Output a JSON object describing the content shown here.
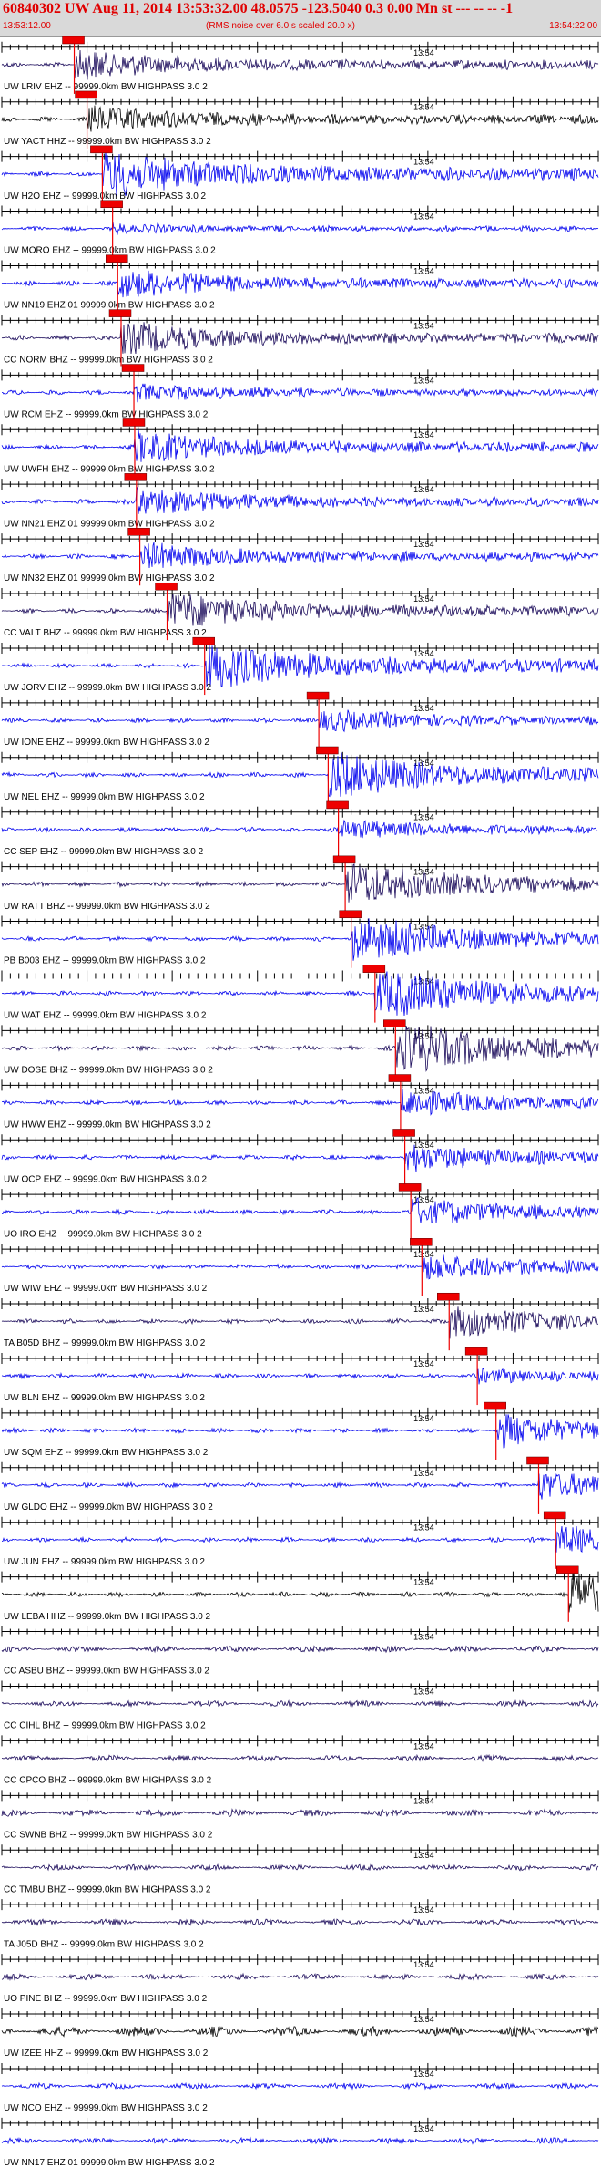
{
  "header": {
    "title": "60840302 UW Aug 11, 2014 13:53:32.00   48.0575 -123.5040  0.3 0.00 Mn st --- -- --   -1",
    "start_time": "13:53:12.00",
    "note": "(RMS noise over 6.0 s scaled 20.0 x)",
    "end_time": "13:54:22.00"
  },
  "colors": {
    "blue": "#0000ee",
    "navy": "#1a0a5a",
    "black": "#000000",
    "pick": "#ee0000",
    "header_bg": "#d9d9d9"
  },
  "chart_data": {
    "type": "line",
    "title": "60840302 UW Aug 11, 2014 13:53:32.00   48.0575 -123.5040  0.3 0.00 Mn st --- -- --   -1",
    "x_range": [
      "13:53:12.00",
      "13:54:22.00"
    ],
    "minute_marker": "13:54",
    "series": [
      {
        "name": "UW LRIV EHZ -- 99999.0km BW  HIGHPASS  3.0  2",
        "color": "navy",
        "pick_s": 8.5,
        "amp": 0.55
      },
      {
        "name": "UW YACT HHZ -- 99999.0km BW  HIGHPASS  3.0  2",
        "color": "black",
        "pick_s": 10.0,
        "amp": 0.5
      },
      {
        "name": "UW H2O EHZ -- 99999.0km BW  HIGHPASS  3.0  2",
        "color": "blue",
        "pick_s": 11.8,
        "amp": 0.9
      },
      {
        "name": "UW MORO EHZ -- 99999.0km BW  HIGHPASS  3.0  2",
        "color": "blue",
        "pick_s": 13.0,
        "amp": 0.15
      },
      {
        "name": "UW NN19 EHZ 01 99999.0km BW  HIGHPASS  3.0  2",
        "color": "blue",
        "pick_s": 13.6,
        "amp": 0.55
      },
      {
        "name": "CC NORM BHZ -- 99999.0km BW  HIGHPASS  3.0  2",
        "color": "navy",
        "pick_s": 14.0,
        "amp": 0.6
      },
      {
        "name": "UW RCM EHZ -- 99999.0km BW  HIGHPASS  3.0  2",
        "color": "blue",
        "pick_s": 15.5,
        "amp": 0.3
      },
      {
        "name": "UW UWFH EHZ -- 99999.0km BW  HIGHPASS  3.0  2",
        "color": "blue",
        "pick_s": 15.6,
        "amp": 0.6
      },
      {
        "name": "UW NN21 EHZ 01 99999.0km BW  HIGHPASS  3.0  2",
        "color": "blue",
        "pick_s": 15.8,
        "amp": 0.5
      },
      {
        "name": "UW NN32 EHZ 01 99999.0km BW  HIGHPASS  3.0  2",
        "color": "blue",
        "pick_s": 16.2,
        "amp": 0.5
      },
      {
        "name": "CC VALT BHZ -- 99999.0km BW  HIGHPASS  3.0  2",
        "color": "navy",
        "pick_s": 19.4,
        "amp": 0.7
      },
      {
        "name": "UW JORV EHZ -- 99999.0km BW  HIGHPASS  3.0  2",
        "color": "blue",
        "pick_s": 23.8,
        "amp": 0.9
      },
      {
        "name": "UW IONE EHZ -- 99999.0km BW  HIGHPASS  3.0  2",
        "color": "blue",
        "pick_s": 37.2,
        "amp": 0.4
      },
      {
        "name": "UW NEL EHZ -- 99999.0km BW  HIGHPASS  3.0  2",
        "color": "blue",
        "pick_s": 38.3,
        "amp": 0.9
      },
      {
        "name": "CC SEP EHZ -- 99999.0km BW  HIGHPASS  3.0  2",
        "color": "blue",
        "pick_s": 39.5,
        "amp": 0.35
      },
      {
        "name": "UW RATT BHZ -- 99999.0km BW  HIGHPASS  3.0  2",
        "color": "navy",
        "pick_s": 40.3,
        "amp": 0.8
      },
      {
        "name": "PB B003 EHZ -- 99999.0km BW  HIGHPASS  3.0  2",
        "color": "blue",
        "pick_s": 41.0,
        "amp": 0.9
      },
      {
        "name": "UW WAT EHZ -- 99999.0km BW  HIGHPASS  3.0  2",
        "color": "blue",
        "pick_s": 43.8,
        "amp": 1.0
      },
      {
        "name": "UW DOSE BHZ -- 99999.0km BW  HIGHPASS  3.0  2",
        "color": "navy",
        "pick_s": 46.2,
        "amp": 1.0
      },
      {
        "name": "UW HWW EHZ -- 99999.0km BW  HIGHPASS  3.0  2",
        "color": "blue",
        "pick_s": 46.8,
        "amp": 0.5
      },
      {
        "name": "UW OCP EHZ -- 99999.0km BW  HIGHPASS  3.0  2",
        "color": "blue",
        "pick_s": 47.3,
        "amp": 0.5
      },
      {
        "name": "UO IRO EHZ -- 99999.0km BW  HIGHPASS  3.0  2",
        "color": "blue",
        "pick_s": 48.0,
        "amp": 0.5
      },
      {
        "name": "UW WIW EHZ -- 99999.0km BW  HIGHPASS  3.0  2",
        "color": "blue",
        "pick_s": 49.3,
        "amp": 0.5
      },
      {
        "name": "TA B05D BHZ -- 99999.0km BW  HIGHPASS  3.0  2",
        "color": "navy",
        "pick_s": 52.5,
        "amp": 0.6
      },
      {
        "name": "UW BLN EHZ -- 99999.0km BW  HIGHPASS  3.0  2",
        "color": "blue",
        "pick_s": 55.8,
        "amp": 0.25
      },
      {
        "name": "UW SQM EHZ -- 99999.0km BW  HIGHPASS  3.0  2",
        "color": "blue",
        "pick_s": 58.0,
        "amp": 0.6
      },
      {
        "name": "UW GLDO EHZ -- 99999.0km BW  HIGHPASS  3.0  2",
        "color": "blue",
        "pick_s": 63.0,
        "amp": 0.5
      },
      {
        "name": "UW JUN EHZ -- 99999.0km BW  HIGHPASS  3.0  2",
        "color": "blue",
        "pick_s": 65.0,
        "amp": 0.5
      },
      {
        "name": "UW LEBA HHZ -- 99999.0km BW  HIGHPASS  3.0  2",
        "color": "black",
        "pick_s": 66.5,
        "amp": 0.8
      },
      {
        "name": "CC ASBU BHZ -- 99999.0km BW  HIGHPASS  3.0  2",
        "color": "navy",
        "pick_s": null,
        "amp": 0.3
      },
      {
        "name": "CC CIHL BHZ -- 99999.0km BW  HIGHPASS  3.0  2",
        "color": "navy",
        "pick_s": null,
        "amp": 0.3
      },
      {
        "name": "CC CPCO BHZ -- 99999.0km BW  HIGHPASS  3.0  2",
        "color": "navy",
        "pick_s": null,
        "amp": 0.3
      },
      {
        "name": "CC SWNB BHZ -- 99999.0km BW  HIGHPASS  3.0  2",
        "color": "navy",
        "pick_s": null,
        "amp": 0.35
      },
      {
        "name": "CC TMBU BHZ -- 99999.0km BW  HIGHPASS  3.0  2",
        "color": "navy",
        "pick_s": null,
        "amp": 0.3
      },
      {
        "name": "TA J05D BHZ -- 99999.0km BW  HIGHPASS  3.0  2",
        "color": "navy",
        "pick_s": null,
        "amp": 0.3
      },
      {
        "name": "UO PINE BHZ -- 99999.0km BW  HIGHPASS  3.0  2",
        "color": "navy",
        "pick_s": null,
        "amp": 0.3
      },
      {
        "name": "UW IZEE HHZ -- 99999.0km BW  HIGHPASS  3.0  2",
        "color": "black",
        "pick_s": null,
        "amp": 0.5
      },
      {
        "name": "UW NCO EHZ -- 99999.0km BW  HIGHPASS  3.0  2",
        "color": "blue",
        "pick_s": null,
        "amp": 0.3
      },
      {
        "name": "UW NN17 EHZ 01 99999.0km BW  HIGHPASS  3.0  2",
        "color": "blue",
        "pick_s": null,
        "amp": 0.3
      }
    ]
  }
}
